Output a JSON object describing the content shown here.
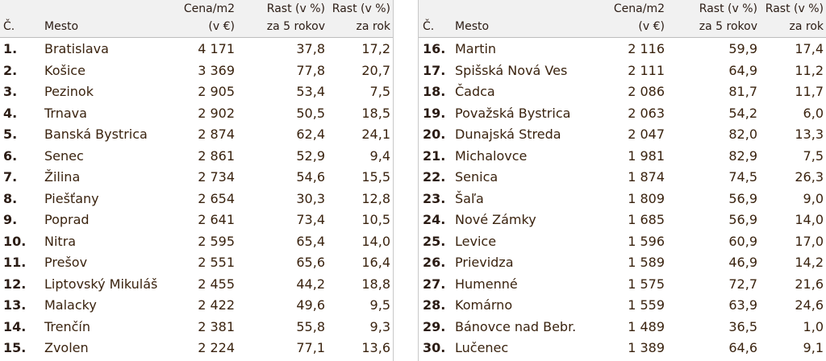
{
  "headers": {
    "c": "Č.",
    "mesto": "Mesto",
    "cena_l1": "Cena/m2",
    "cena_l2": "(v €)",
    "rast5_l1": "Rast (v %)",
    "rast5_l2": "za 5 rokov",
    "rast1_l1": "Rast (v %)",
    "rast1_l2": "za rok"
  },
  "left_rows": [
    {
      "n": "1.",
      "city": "Bratislava",
      "price": "4 171",
      "r5": "37,8",
      "r1": "17,2"
    },
    {
      "n": "2.",
      "city": "Košice",
      "price": "3 369",
      "r5": "77,8",
      "r1": "20,7"
    },
    {
      "n": "3.",
      "city": "Pezinok",
      "price": "2 905",
      "r5": "53,4",
      "r1": "7,5"
    },
    {
      "n": "4.",
      "city": "Trnava",
      "price": "2 902",
      "r5": "50,5",
      "r1": "18,5"
    },
    {
      "n": "5.",
      "city": "Banská Bystrica",
      "price": "2 874",
      "r5": "62,4",
      "r1": "24,1"
    },
    {
      "n": "6.",
      "city": "Senec",
      "price": "2 861",
      "r5": "52,9",
      "r1": "9,4"
    },
    {
      "n": "7.",
      "city": "Žilina",
      "price": "2 734",
      "r5": "54,6",
      "r1": "15,5"
    },
    {
      "n": "8.",
      "city": "Piešťany",
      "price": "2 654",
      "r5": "30,3",
      "r1": "12,8"
    },
    {
      "n": "9.",
      "city": "Poprad",
      "price": "2 641",
      "r5": "73,4",
      "r1": "10,5"
    },
    {
      "n": "10.",
      "city": "Nitra",
      "price": "2 595",
      "r5": "65,4",
      "r1": "14,0"
    },
    {
      "n": "11.",
      "city": "Prešov",
      "price": "2 551",
      "r5": "65,6",
      "r1": "16,4"
    },
    {
      "n": "12.",
      "city": "Liptovský Mikuláš",
      "price": "2 455",
      "r5": "44,2",
      "r1": "18,8"
    },
    {
      "n": "13.",
      "city": "Malacky",
      "price": "2 422",
      "r5": "49,6",
      "r1": "9,5"
    },
    {
      "n": "14.",
      "city": "Trenčín",
      "price": "2 381",
      "r5": "55,8",
      "r1": "9,3"
    },
    {
      "n": "15.",
      "city": "Zvolen",
      "price": "2 224",
      "r5": "77,1",
      "r1": "13,6"
    }
  ],
  "right_rows": [
    {
      "n": "16.",
      "city": "Martin",
      "price": "2 116",
      "r5": "59,9",
      "r1": "17,4"
    },
    {
      "n": "17.",
      "city": "Spišská Nová Ves",
      "price": "2 111",
      "r5": "64,9",
      "r1": "11,2"
    },
    {
      "n": "18.",
      "city": "Čadca",
      "price": "2 086",
      "r5": "81,7",
      "r1": "11,7"
    },
    {
      "n": "19.",
      "city": "Považská Bystrica",
      "price": "2 063",
      "r5": "54,2",
      "r1": "6,0"
    },
    {
      "n": "20.",
      "city": "Dunajská Streda",
      "price": "2 047",
      "r5": "82,0",
      "r1": "13,3"
    },
    {
      "n": "21.",
      "city": "Michalovce",
      "price": "1 981",
      "r5": "82,9",
      "r1": "7,5"
    },
    {
      "n": "22.",
      "city": "Senica",
      "price": "1 874",
      "r5": "74,5",
      "r1": "26,3"
    },
    {
      "n": "23.",
      "city": "Šaľa",
      "price": "1 809",
      "r5": "56,9",
      "r1": "9,0"
    },
    {
      "n": "24.",
      "city": "Nové Zámky",
      "price": "1 685",
      "r5": "56,9",
      "r1": "14,0"
    },
    {
      "n": "25.",
      "city": "Levice",
      "price": "1 596",
      "r5": "60,9",
      "r1": "17,0"
    },
    {
      "n": "26.",
      "city": "Prievidza",
      "price": "1 589",
      "r5": "46,9",
      "r1": "14,2"
    },
    {
      "n": "27.",
      "city": "Humenné",
      "price": "1 575",
      "r5": "72,7",
      "r1": "21,6"
    },
    {
      "n": "28.",
      "city": "Komárno",
      "price": "1 559",
      "r5": "63,9",
      "r1": "24,6"
    },
    {
      "n": "29.",
      "city": "Bánovce nad Bebr.",
      "price": "1 489",
      "r5": "36,5",
      "r1": "1,0"
    },
    {
      "n": "30.",
      "city": "Lučenec",
      "price": "1 389",
      "r5": "64,6",
      "r1": "9,1"
    }
  ]
}
